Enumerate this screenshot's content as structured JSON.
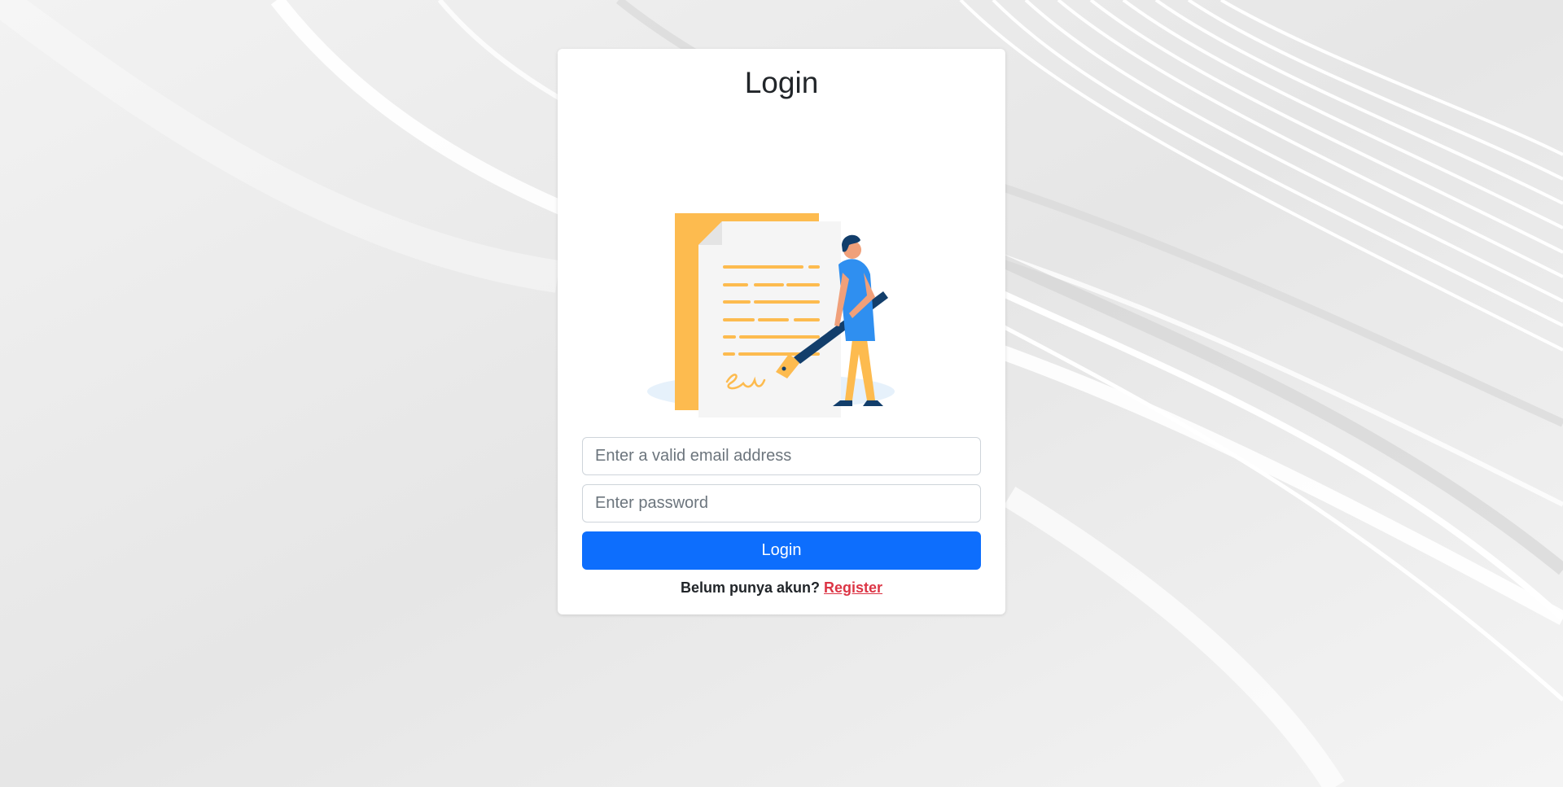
{
  "page": {
    "title": "Login"
  },
  "form": {
    "email_placeholder": "Enter a valid email address",
    "email_value": "",
    "password_placeholder": "Enter password",
    "password_value": "",
    "submit_label": "Login"
  },
  "register": {
    "prompt": "Belum punya akun?",
    "link_label": "Register"
  },
  "colors": {
    "primary": "#0d6efd",
    "link": "#dc3545",
    "illustration_accent": "#fdbb4f",
    "illustration_figure": "#2f8ff0",
    "illustration_dark": "#123e6b"
  },
  "icons": {
    "illustration": "document-signing-illustration"
  }
}
